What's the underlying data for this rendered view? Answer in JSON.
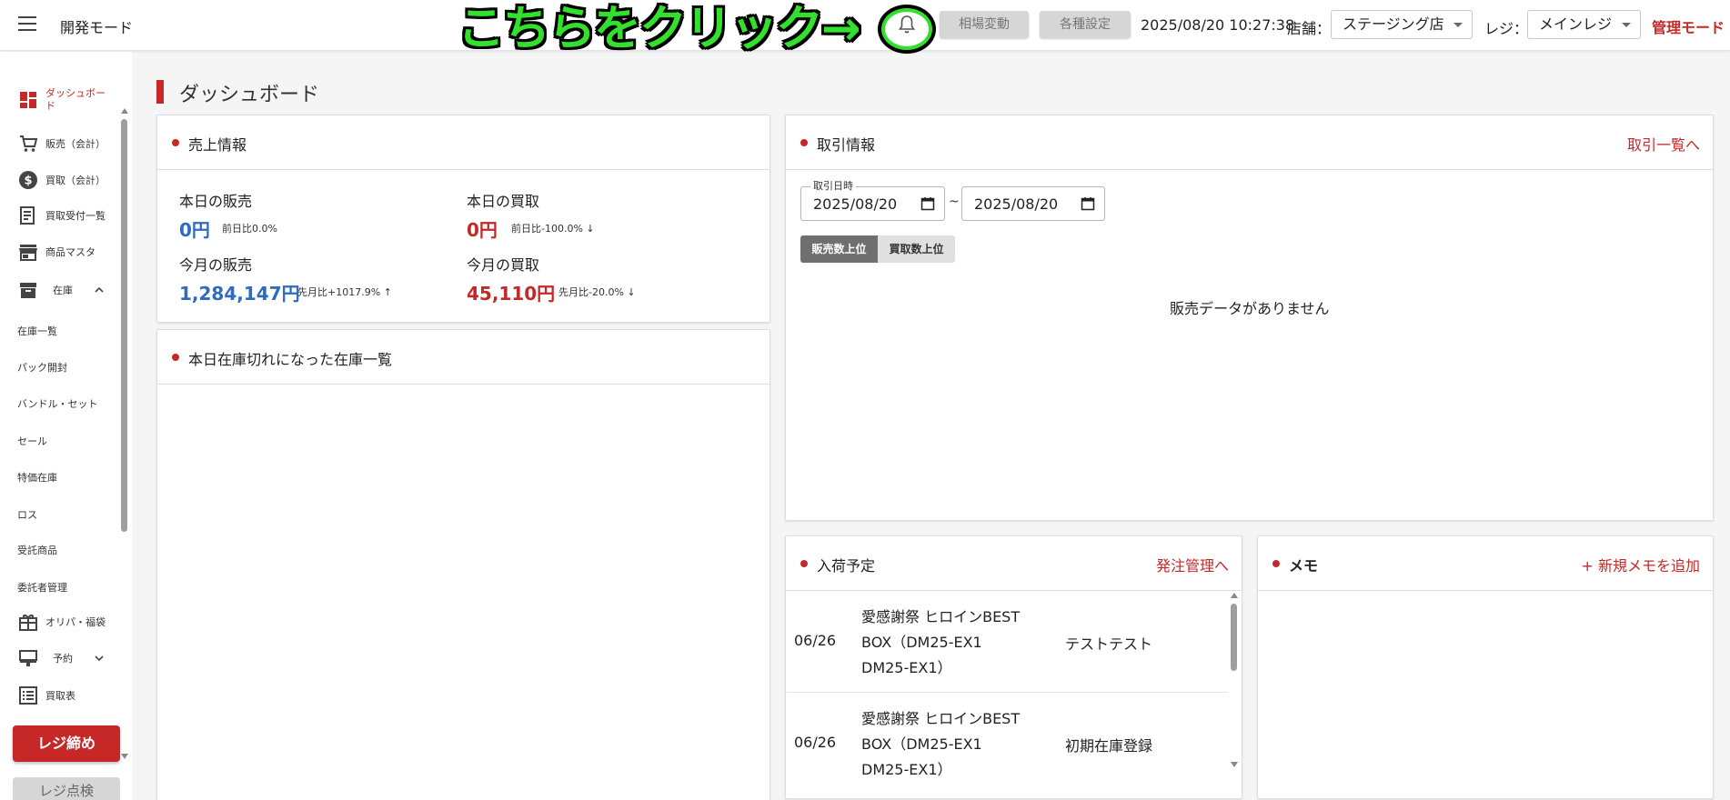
{
  "header": {
    "mode_title": "開発モード",
    "overlay_text": "こちらをクリック→",
    "market_button": "相場変動",
    "settings_button": "各種設定",
    "datetime": "2025/08/20 10:27:38",
    "store_label": "店舗：",
    "store_value": "ステージング店",
    "register_label": "レジ：",
    "register_value": "メインレジ",
    "admin_mode": "管理モード"
  },
  "sidebar": {
    "items": [
      {
        "label": "ダッシュボード",
        "icon": "dashboard-icon"
      },
      {
        "label": "販売（会計）",
        "icon": "cart-icon"
      },
      {
        "label": "買取（会計）",
        "icon": "dollar-icon"
      },
      {
        "label": "買取受付一覧",
        "icon": "receipt-icon"
      },
      {
        "label": "商品マスタ",
        "icon": "store-icon"
      },
      {
        "label": "在庫",
        "icon": "archive-icon"
      }
    ],
    "stock_subitems": [
      "在庫一覧",
      "パック開封",
      "バンドル・セット",
      "セール",
      "特価在庫",
      "ロス",
      "受託商品",
      "委託者管理"
    ],
    "items_after": [
      {
        "label": "オリパ・福袋",
        "icon": "gift-icon"
      },
      {
        "label": "予約",
        "icon": "reservation-icon"
      },
      {
        "label": "買取表",
        "icon": "list-icon"
      }
    ],
    "close_register": "レジ締め",
    "check_register": "レジ点検"
  },
  "page": {
    "title": "ダッシュボード"
  },
  "sales": {
    "title": "売上情報",
    "today_sales_label": "本日の販売",
    "today_sales_value": "0円",
    "today_sales_cmp": "前日比0.0%",
    "today_buy_label": "本日の買取",
    "today_buy_value": "0円",
    "today_buy_cmp": "前日比-100.0% ↓",
    "month_sales_label": "今月の販売",
    "month_sales_value": "1,284,147円",
    "month_sales_cmp": "先月比+1017.9% ↑",
    "month_buy_label": "今月の買取",
    "month_buy_value": "45,110円",
    "month_buy_cmp": "先月比-20.0% ↓"
  },
  "stockout": {
    "title": "本日在庫切れになった在庫一覧"
  },
  "trade": {
    "title": "取引情報",
    "link": "取引一覧へ",
    "date_legend": "取引日時",
    "date_from": "2025/08/20",
    "date_to": "2025/08/20",
    "tilde": "~",
    "tab_sales": "販売数上位",
    "tab_buy": "買取数上位",
    "no_data": "販売データがありません"
  },
  "arrival": {
    "title": "入荷予定",
    "link": "発注管理へ",
    "rows": [
      {
        "date": "06/26",
        "name": "愛感謝祭 ヒロインBEST BOX（DM25-EX1 DM25-EX1）",
        "note": "テストテスト"
      },
      {
        "date": "06/26",
        "name": "愛感謝祭 ヒロインBEST BOX（DM25-EX1 DM25-EX1）",
        "note": "初期在庫登録"
      }
    ]
  },
  "memo": {
    "title": "メモ",
    "add": "+ 新規メモを追加"
  },
  "colors": {
    "accent": "#c62828",
    "blue": "#2c6bc0",
    "overlay_green": "#33e02b"
  }
}
